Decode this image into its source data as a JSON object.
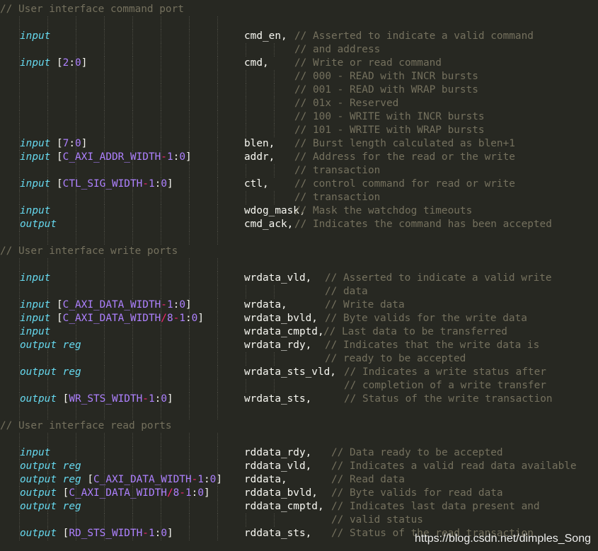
{
  "editor": {
    "lines": [
      {
        "comment": "// User interface command port"
      },
      {},
      {
        "dir": "input",
        "name": "cmd_en,",
        "comment": "// Asserted to indicate a valid command"
      },
      {
        "comment": "// and address",
        "cont": true
      },
      {
        "dir": "input",
        "range": [
          "2",
          ":",
          "0"
        ],
        "name": "cmd,",
        "comment": "// Write or read command"
      },
      {
        "comment": "// 000 - READ with INCR bursts",
        "cont": true
      },
      {
        "comment": "// 001 - READ with WRAP bursts",
        "cont": true
      },
      {
        "comment": "// 01x - Reserved",
        "cont": true
      },
      {
        "comment": "// 100 - WRITE with INCR bursts",
        "cont": true
      },
      {
        "comment": "// 101 - WRITE with WRAP bursts",
        "cont": true
      },
      {
        "dir": "input",
        "range": [
          "7",
          ":",
          "0"
        ],
        "name": "blen,",
        "comment": "// Burst length calculated as blen+1"
      },
      {
        "dir": "input",
        "range": [
          "C_AXI_ADDR_WIDTH",
          "-",
          "1",
          ":",
          "0"
        ],
        "name": "addr,",
        "comment": "// Address for the read or the write"
      },
      {
        "comment": "// transaction",
        "cont": true
      },
      {
        "dir": "input",
        "range": [
          "CTL_SIG_WIDTH",
          "-",
          "1",
          ":",
          "0"
        ],
        "name": "ctl,",
        "comment": "// control command for read or write"
      },
      {
        "comment": "// transaction",
        "cont": true
      },
      {
        "dir": "input",
        "name": "wdog_mask,",
        "comment": "// Mask the watchdog timeouts"
      },
      {
        "dir": "output",
        "name": "cmd_ack,",
        "comment": "// Indicates the command has been accepted",
        "tight": true
      },
      {},
      {
        "comment": "// User interface write ports"
      },
      {},
      {
        "dir": "input",
        "name": "wrdata_vld,",
        "comment": "// Asserted to indicate a valid write"
      },
      {
        "comment": "// data",
        "cont": true
      },
      {
        "dir": "input",
        "range": [
          "C_AXI_DATA_WIDTH",
          "-",
          "1",
          ":",
          "0"
        ],
        "name": "wrdata,",
        "comment": "// Write data"
      },
      {
        "dir": "input",
        "range": [
          "C_AXI_DATA_WIDTH",
          "/",
          "8",
          "-",
          "1",
          ":",
          "0"
        ],
        "name": "wrdata_bvld,",
        "comment": "// Byte valids for the write data"
      },
      {
        "dir": "input",
        "name": "wrdata_cmptd,",
        "comment": "// Last data to be transferred",
        "tight": true
      },
      {
        "dir": "output reg",
        "name": "wrdata_rdy,",
        "comment": "// Indicates that the write data is"
      },
      {
        "comment": "// ready to be accepted",
        "cont": true
      },
      {
        "dir": "output reg",
        "name": "wrdata_sts_vld,",
        "comment": "// Indicates a write status after"
      },
      {
        "comment": "// completion of a write transfer",
        "cont": true
      },
      {
        "dir": "output",
        "range": [
          "WR_STS_WIDTH",
          "-",
          "1",
          ":",
          "0"
        ],
        "name": "wrdata_sts,",
        "comment": "// Status of the write transaction"
      },
      {},
      {
        "comment": "// User interface read ports"
      },
      {},
      {
        "dir": "input",
        "name": "rddata_rdy,",
        "comment": "// Data ready to be accepted"
      },
      {
        "dir": "output reg",
        "name": "rddata_vld,",
        "comment": "// Indicates a valid read data available"
      },
      {
        "dir": "output reg",
        "range": [
          "C_AXI_DATA_WIDTH",
          "-",
          "1",
          ":",
          "0"
        ],
        "name": "rddata,",
        "comment": "// Read data"
      },
      {
        "dir": "output",
        "range": [
          "C_AXI_DATA_WIDTH",
          "/",
          "8",
          "-",
          "1",
          ":",
          "0"
        ],
        "name": "rddata_bvld,",
        "comment": "// Byte valids for read data"
      },
      {
        "dir": "output reg",
        "name": "rddata_cmptd,",
        "comment": "// Indicates last data present and"
      },
      {
        "comment": "// valid status",
        "cont": true
      },
      {
        "dir": "output",
        "range": [
          "RD_STS_WIDTH",
          "-",
          "1",
          ":",
          "0"
        ],
        "name": "rddata_sts,",
        "comment": "// Status of the read transaction"
      }
    ]
  },
  "watermark": "https://blog.csdn.net/dimples_Song",
  "colors": {
    "background": "#272822",
    "comment": "#75715e",
    "keyword": "#66d9ef",
    "number": "#ae81ff",
    "operator": "#f92672",
    "identifier": "#f8f8f2"
  }
}
